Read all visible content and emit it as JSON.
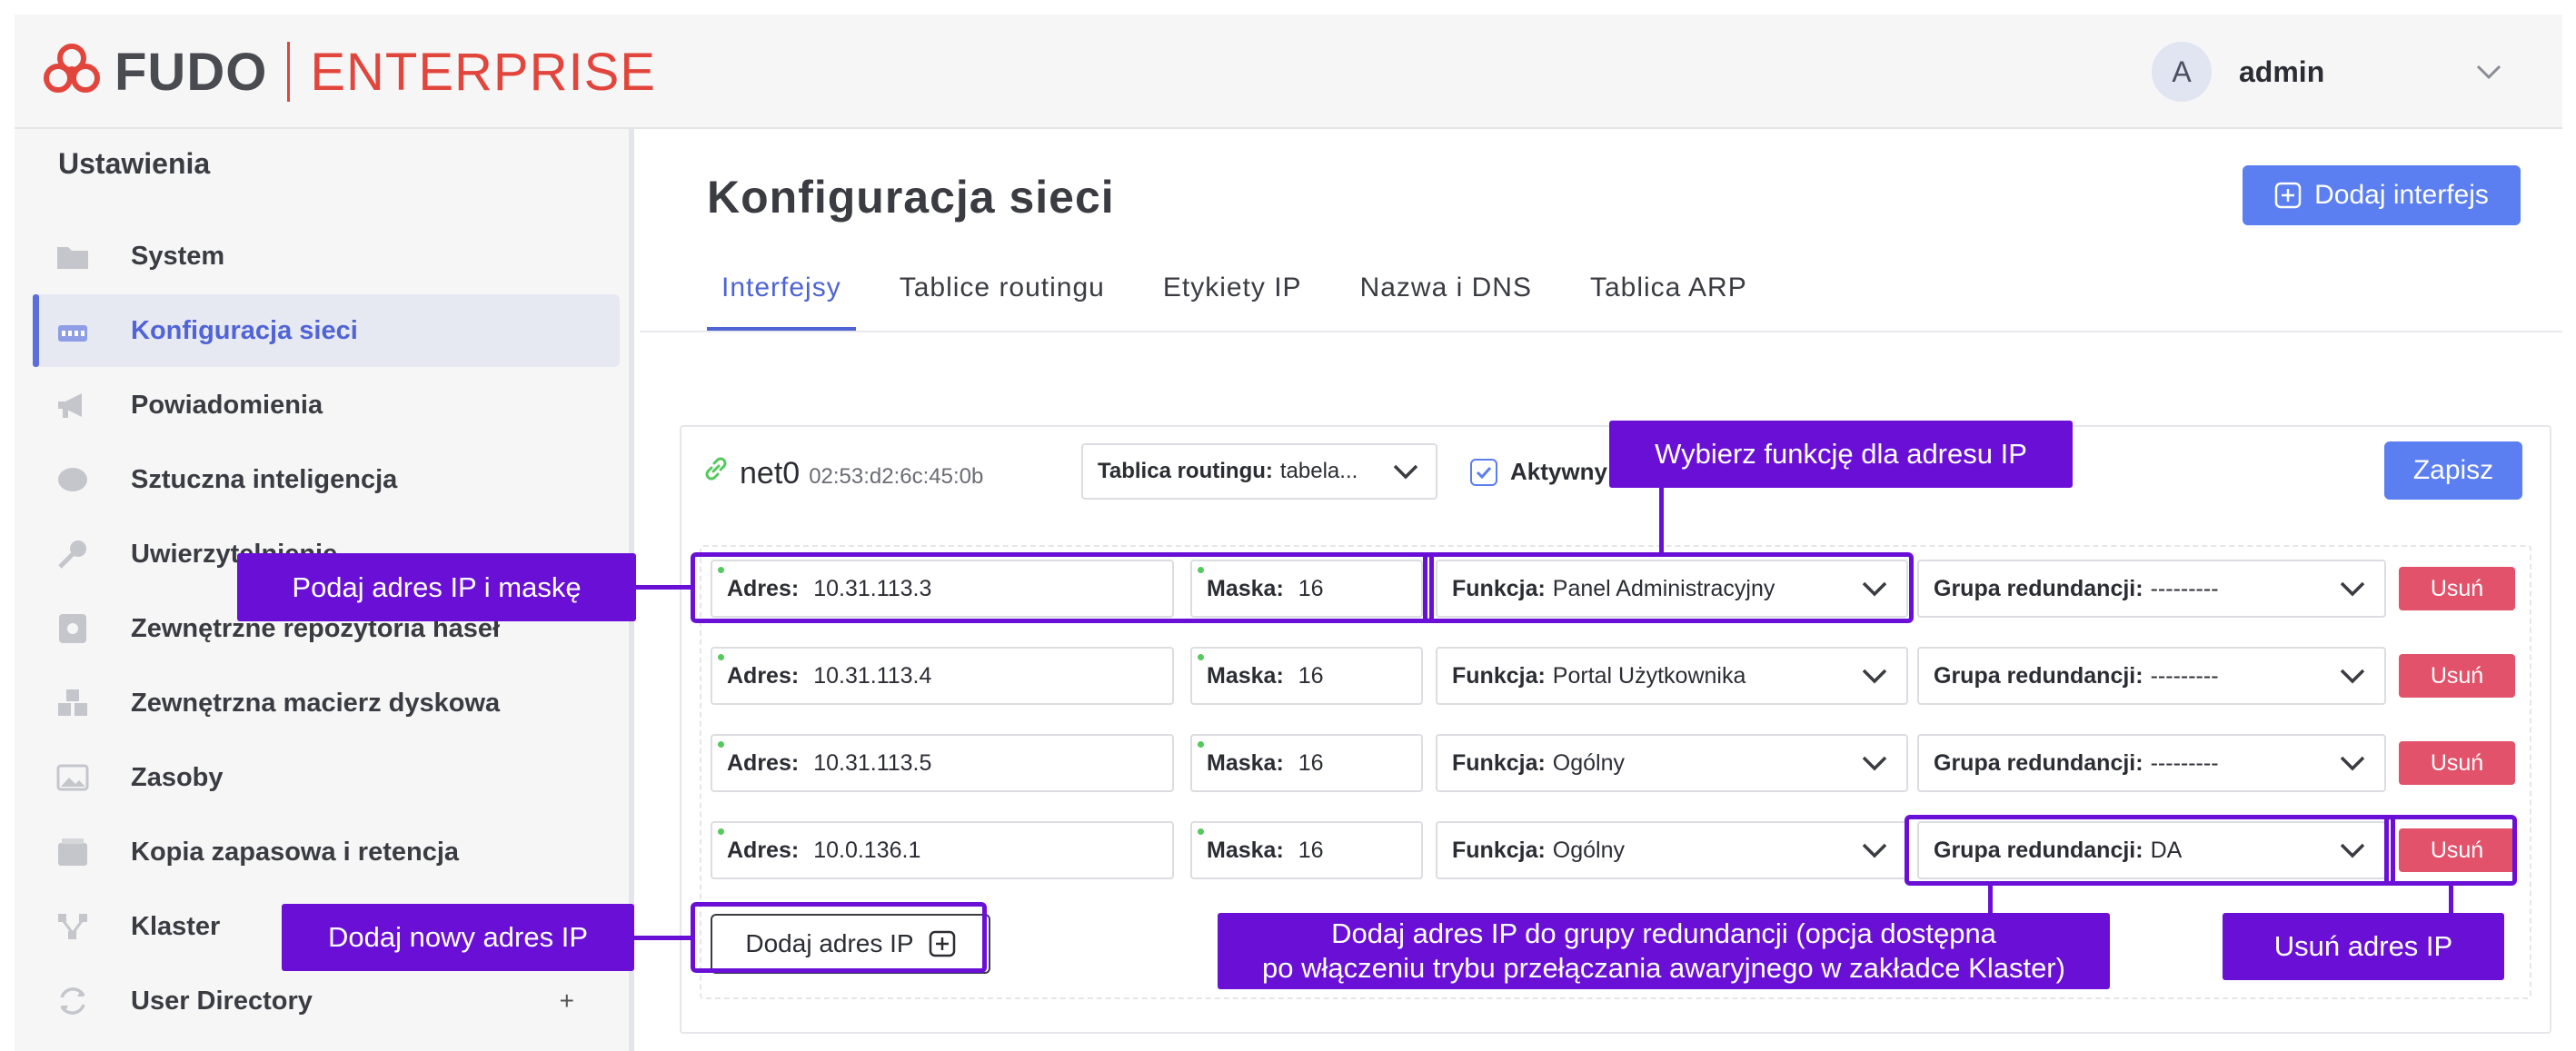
{
  "header": {
    "brand_primary": "FUDO",
    "brand_secondary": "ENTERPRISE",
    "avatar_initial": "A",
    "user_name": "admin"
  },
  "sidebar": {
    "title": "Ustawienia",
    "items": [
      {
        "label": "System",
        "icon": "folder-icon"
      },
      {
        "label": "Konfiguracja sieci",
        "icon": "network-icon",
        "active": true
      },
      {
        "label": "Powiadomienia",
        "icon": "megaphone-icon"
      },
      {
        "label": "Sztuczna inteligencja",
        "icon": "brain-icon"
      },
      {
        "label": "Uwierzytelnienie",
        "icon": "key-icon"
      },
      {
        "label": "Zewnętrzne repozytoria haseł",
        "icon": "safe-icon"
      },
      {
        "label": "Zewnętrzna macierz dyskowa",
        "icon": "storage-icon"
      },
      {
        "label": "Zasoby",
        "icon": "image-icon"
      },
      {
        "label": "Kopia zapasowa i retencja",
        "icon": "archive-icon"
      },
      {
        "label": "Klaster",
        "icon": "cluster-icon"
      },
      {
        "label": "User Directory",
        "icon": "sync-icon",
        "expand": "+"
      }
    ]
  },
  "main": {
    "title": "Konfiguracja sieci",
    "add_interface_label": "Dodaj interfejs",
    "tabs": [
      {
        "label": "Interfejsy",
        "active": true
      },
      {
        "label": "Tablice routingu"
      },
      {
        "label": "Etykiety IP"
      },
      {
        "label": "Nazwa i DNS"
      },
      {
        "label": "Tablica ARP"
      }
    ],
    "interface": {
      "name": "net0",
      "mac": "02:53:d2:6c:45:0b",
      "routing_label": "Tablica routingu:",
      "routing_value": "tabela...",
      "active_label": "Aktywny",
      "active_checked": true,
      "save_label": "Zapisz"
    },
    "field_labels": {
      "address": "Adres:",
      "mask": "Maska:",
      "function": "Funkcja:",
      "group": "Grupa redundancji:",
      "delete": "Usuń"
    },
    "addresses": [
      {
        "address": "10.31.113.3",
        "mask": "16",
        "function": "Panel Administracyjny",
        "group": "---------"
      },
      {
        "address": "10.31.113.4",
        "mask": "16",
        "function": "Portal Użytkownika",
        "group": "---------"
      },
      {
        "address": "10.31.113.5",
        "mask": "16",
        "function": "Ogólny",
        "group": "---------"
      },
      {
        "address": "10.0.136.1",
        "mask": "16",
        "function": "Ogólny",
        "group": "DA"
      }
    ],
    "add_ip_label": "Dodaj adres IP"
  },
  "annotations": {
    "ip_mask": "Podaj adres IP i maskę",
    "function": "Wybierz funkcję dla adresu IP",
    "add_ip": "Dodaj nowy adres IP",
    "group_line1": "Dodaj adres IP do grupy redundancji (opcja dostępna",
    "group_line2": "po włączeniu trybu przełączania awaryjnego w zakładce Klaster)",
    "delete_ip": "Usuń adres IP",
    "color": "#6a0fd6"
  },
  "colors": {
    "accent": "#5b7ef0",
    "brand": "#e2453c",
    "danger": "#e2526a",
    "status_ok": "#54c95c"
  }
}
